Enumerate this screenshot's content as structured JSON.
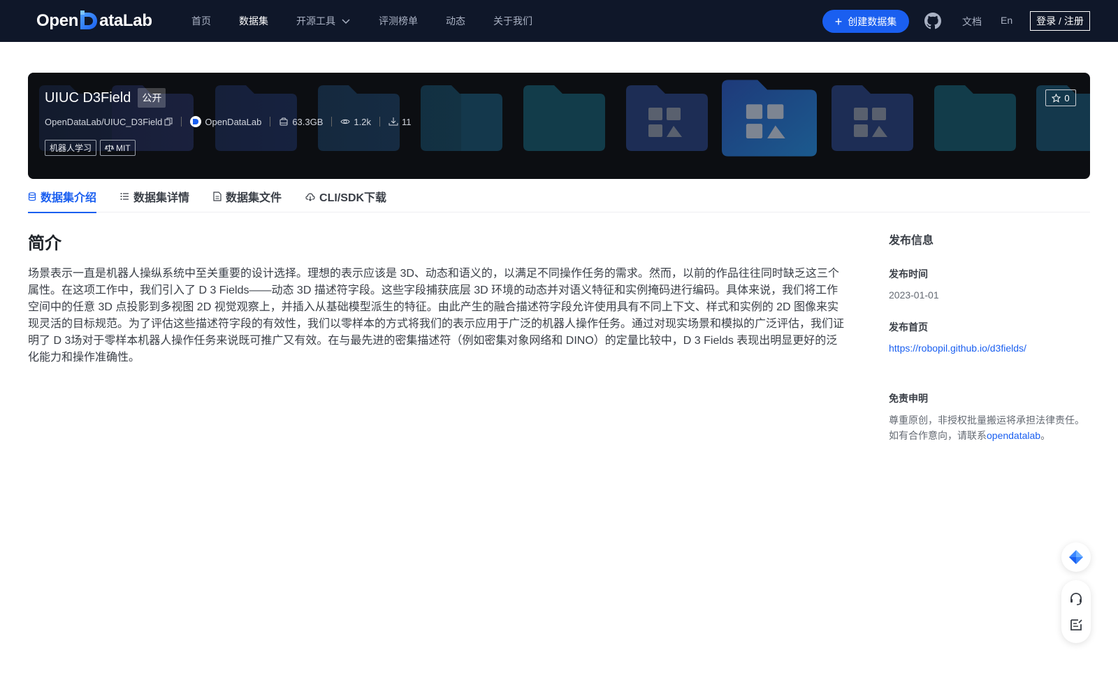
{
  "brand": {
    "logo_text_left": "Open",
    "logo_text_right": "ataLab"
  },
  "nav": {
    "items": [
      {
        "label": "首页"
      },
      {
        "label": "数据集",
        "active": true
      },
      {
        "label": "开源工具",
        "has_dropdown": true
      },
      {
        "label": "评测榜单"
      },
      {
        "label": "动态"
      },
      {
        "label": "关于我们"
      }
    ],
    "create_label": "创建数据集",
    "docs_label": "文档",
    "lang_label": "En",
    "login_label": "登录 / 注册"
  },
  "dataset": {
    "name": "UIUC D3Field",
    "visibility": "公开",
    "path": "OpenDataLab/UIUC_D3Field",
    "org": "OpenDataLab",
    "size": "63.3GB",
    "views": "1.2k",
    "downloads": "11",
    "tags": [
      "机器人学习",
      "MIT"
    ],
    "stars": "0"
  },
  "tabs": [
    {
      "label": "数据集介绍",
      "icon": "database-icon",
      "active": true
    },
    {
      "label": "数据集详情",
      "icon": "list-icon"
    },
    {
      "label": "数据集文件",
      "icon": "file-icon"
    },
    {
      "label": "CLI/SDK下载",
      "icon": "cloud-download-icon"
    }
  ],
  "intro": {
    "heading": "简介",
    "body": "场景表示一直是机器人操纵系统中至关重要的设计选择。理想的表示应该是 3D、动态和语义的，以满足不同操作任务的需求。然而，以前的作品往往同时缺乏这三个属性。在这项工作中，我们引入了 D 3 Fields——动态 3D 描述符字段。这些字段捕获底层 3D 环境的动态并对语义特征和实例掩码进行编码。具体来说，我们将工作空间中的任意 3D 点投影到多视图 2D 视觉观察上，并插入从基础模型派生的特征。由此产生的融合描述符字段允许使用具有不同上下文、样式和实例的 2D 图像来实现灵活的目标规范。为了评估这些描述符字段的有效性，我们以零样本的方式将我们的表示应用于广泛的机器人操作任务。通过对现实场景和模拟的广泛评估，我们证明了 D 3场对于零样本机器人操作任务来说既可推广又有效。在与最先进的密集描述符（例如密集对象网络和 DINO）的定量比较中，D 3 Fields 表现出明显更好的泛化能力和操作准确性。"
  },
  "sidebar": {
    "heading": "发布信息",
    "time_label": "发布时间",
    "time_value": "2023-01-01",
    "home_label": "发布首页",
    "home_url": "https://robopil.github.io/d3fields/",
    "disclaimer_label": "免责申明",
    "disclaimer_line1": "尊重原创，非授权批量搬运将承担法律责任。",
    "disclaimer_line2_prefix": "如有合作意向，请联系",
    "disclaimer_link": "opendatalab",
    "disclaimer_line2_suffix": "。"
  },
  "icons": {
    "float_top": "feishu-icon",
    "float_support": "headset-icon",
    "float_feedback": "edit-note-icon"
  },
  "colors": {
    "accent": "#1a5ff0",
    "topbar": "#0f1729",
    "banner": "#0c0e12"
  }
}
